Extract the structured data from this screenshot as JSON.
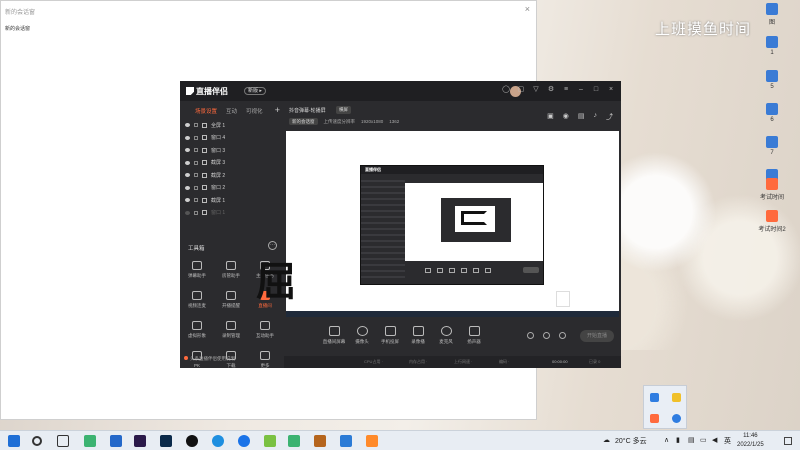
{
  "desktop": {
    "overlay_text": "上班摸鱼时间",
    "icons": [
      {
        "label": "图",
        "color": "#3a7bd5"
      },
      {
        "label": "1",
        "color": "#3a7bd5"
      },
      {
        "label": "5",
        "color": "#3a7bd5"
      },
      {
        "label": "6",
        "color": "#3a7bd5"
      },
      {
        "label": "7",
        "color": "#3a7bd5"
      },
      {
        "label": "8",
        "color": "#3a7bd5"
      },
      {
        "label": "考试时间",
        "color": "#ff6a3d"
      },
      {
        "label": "考试时间2",
        "color": "#ff6a3d"
      }
    ]
  },
  "bg_window": {
    "title": "新的会话窗",
    "subtitle": "新的会话窗",
    "close": "×"
  },
  "app": {
    "logo": "直播伴侣",
    "badge": "新版 ▸",
    "tabs": [
      {
        "label": "场景设置",
        "active": true
      },
      {
        "label": "互动",
        "active": false
      },
      {
        "label": "可视化",
        "active": false
      }
    ],
    "add": "+",
    "sources": [
      {
        "label": "全屏 1",
        "dim": false
      },
      {
        "label": "窗口 4",
        "dim": false
      },
      {
        "label": "窗口 3",
        "dim": false
      },
      {
        "label": "截屏 3",
        "dim": false
      },
      {
        "label": "截屏 2",
        "dim": false
      },
      {
        "label": "窗口 2",
        "dim": false
      },
      {
        "label": "截屏 1",
        "dim": false
      },
      {
        "label": "窗口 1",
        "dim": true
      }
    ],
    "toolbox_label": "工具箱",
    "toolbox_more": "···",
    "tools": [
      {
        "label": "弹幕助手",
        "hot": false
      },
      {
        "label": "房管助手",
        "hot": false
      },
      {
        "label": "主播任务",
        "hot": false
      },
      {
        "label": "视频连麦",
        "hot": false
      },
      {
        "label": "开播提醒",
        "hot": false
      },
      {
        "label": "直播间",
        "hot": true
      },
      {
        "label": "虚拟形象",
        "hot": false
      },
      {
        "label": "录制管理",
        "hot": false
      },
      {
        "label": "互动助手",
        "hot": false
      },
      {
        "label": "PK",
        "hot": false
      },
      {
        "label": "下载",
        "hot": false
      },
      {
        "label": "更多",
        "hot": false
      }
    ],
    "status_left": "头条直播伴侣使用说明",
    "scene": {
      "name": "抖音弹幕-轮播屏",
      "tag": "横屏",
      "chip": "新的会话窗",
      "resolution": "上传速度分辨率",
      "dims": "1920x1080",
      "fps": "1362"
    },
    "canvas_bigtext": "屈",
    "bottom_buttons": [
      {
        "label": "直播间屏幕"
      },
      {
        "label": "摄像头"
      },
      {
        "label": "手机投屏"
      },
      {
        "label": "录像播"
      },
      {
        "label": "麦克风"
      },
      {
        "label": "扬声器"
      }
    ],
    "go_live": "开始直播",
    "status_items": [
      "CPU占用 ·",
      "内存占用 ·",
      "上行网速 ·",
      "编码 ·",
      "00:00:00",
      "已录 0"
    ]
  },
  "taskbar": {
    "weather": "20°C 多云",
    "lang": "英",
    "time": "11:46",
    "date": "2022/1/25"
  }
}
